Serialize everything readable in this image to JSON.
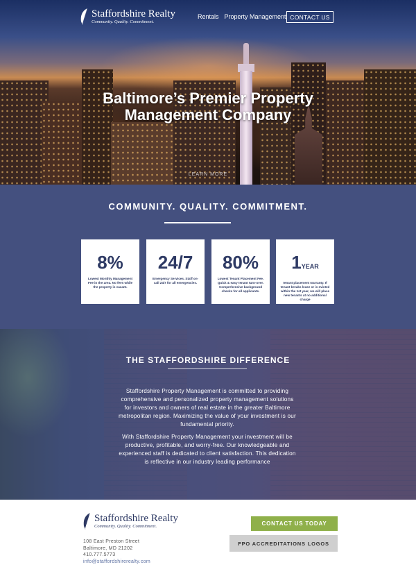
{
  "brand": {
    "name": "Staffordshire Realty",
    "tagline": "Community. Quality. Commitment."
  },
  "nav": {
    "links": [
      "Rentals",
      "Property Management"
    ],
    "cta": "CONTACT US"
  },
  "hero": {
    "title_line1": "Baltimore’s Premier Property",
    "title_line2": "Management Company",
    "learn_more": "LEARN MORE"
  },
  "stats": {
    "heading": "COMMUNITY. QUALITY. COMMITMENT.",
    "cards": [
      {
        "value": "8%",
        "unit": "",
        "desc": "Lowest Monthly Management Fee in the area. No fees while the property is vacant."
      },
      {
        "value": "24/7",
        "unit": "",
        "desc": "Emergency Services. Staff on-call 24/7 for all emergencies."
      },
      {
        "value": "80%",
        "unit": "",
        "desc": "Lowest Tenant Placement Fee. Quick & easy tenant turn-over. Comprehensive background checks for all applicants."
      },
      {
        "value": "1",
        "unit": "YEAR",
        "desc": "tenant placement warranty. If tenant breaks lease or is evicted within the 1st year, we will place new tenants at no additional charge"
      }
    ]
  },
  "difference": {
    "heading": "THE STAFFORDSHIRE DIFFERENCE",
    "paragraph1": "Staffordshire Property Management is committed to providing comprehensive and personalized property management solutions for investors and owners of real estate in the greater Baltimore metropolitan region. Maximizing the value of your investment is our fundamental priority.",
    "paragraph2": "With Staffordshire Property Management your investment will be productive, profitable, and worry-free. Our knowledgeable and experienced staff is dedicated to client satisfaction. This dedication is reflective in our industry leading performance"
  },
  "footer": {
    "address_line1": "108 East Preston Street",
    "address_line2": "Baltimore, MD 21202",
    "phone": "410.777.5773",
    "email": "info@staffordshirerealty.com",
    "contact_button": "CONTACT US TODAY",
    "accreditations": "FPO ACCREDITATIONS LOGOS"
  },
  "colors": {
    "navy": "#44507f",
    "dark_navy": "#2e3a64",
    "green": "#8fb04a",
    "gray": "#cfcfcf"
  }
}
